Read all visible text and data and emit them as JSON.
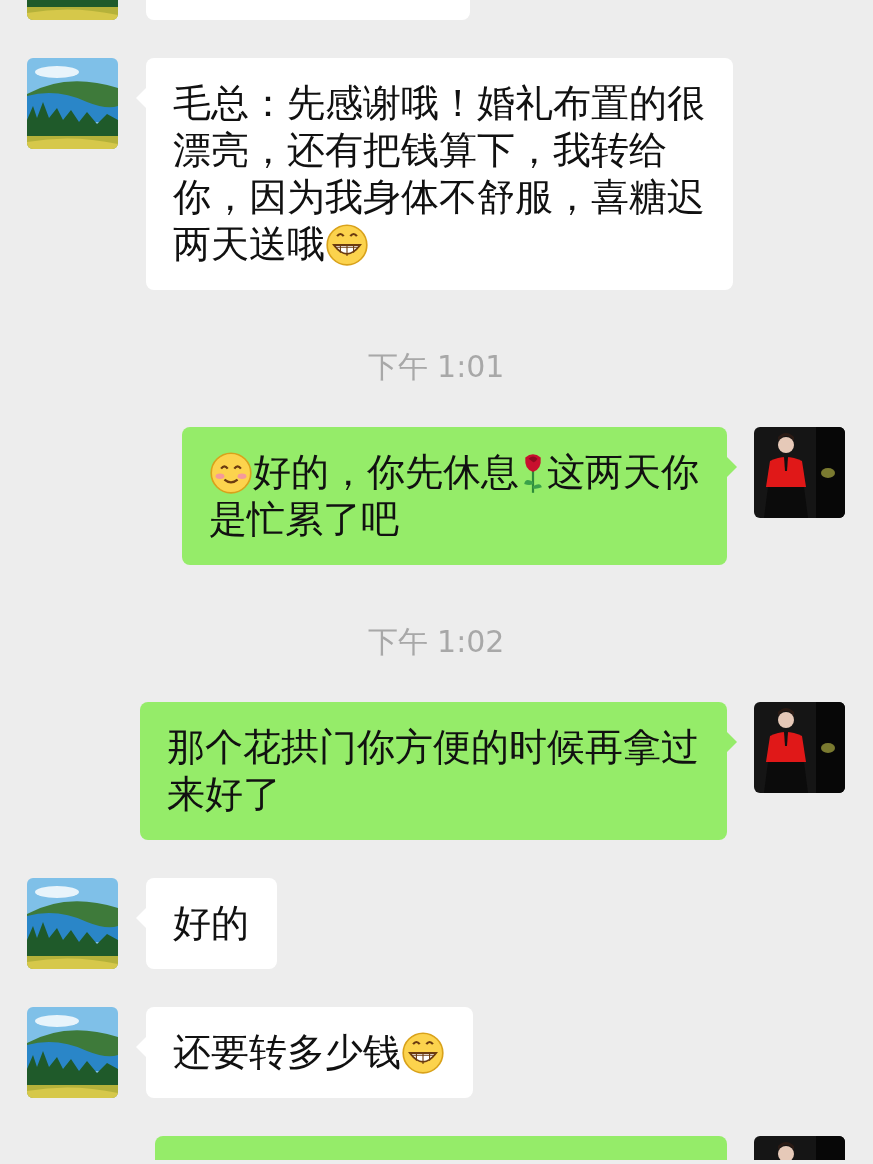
{
  "messages": [
    {
      "kind": "cut",
      "outgoing": false,
      "cut_top": true
    },
    {
      "kind": "message",
      "outgoing": false,
      "lines": [
        [
          {
            "kind": "text",
            "text": "毛总：先感谢哦！婚礼布置的很"
          }
        ],
        [
          {
            "kind": "text",
            "text": "漂亮，还有把钱算下，我转给"
          }
        ],
        [
          {
            "kind": "text",
            "text": "你，因为我身体不舒服，喜糖迟"
          }
        ],
        [
          {
            "kind": "text",
            "text": "两天送哦"
          },
          {
            "kind": "grin"
          }
        ]
      ]
    },
    {
      "kind": "time",
      "text": "下午 1:01"
    },
    {
      "kind": "message",
      "outgoing": true,
      "lines": [
        [
          {
            "kind": "smile"
          },
          {
            "kind": "text",
            "text": "好的，你先休息"
          },
          {
            "kind": "rose"
          },
          {
            "kind": "text",
            "text": "这两天你"
          }
        ],
        [
          {
            "kind": "text",
            "text": "是忙累了吧"
          }
        ]
      ]
    },
    {
      "kind": "time",
      "text": "下午 1:02"
    },
    {
      "kind": "message",
      "outgoing": true,
      "lines": [
        [
          {
            "kind": "text",
            "text": "那个花拱门你方便的时候再拿过"
          }
        ],
        [
          {
            "kind": "text",
            "text": "来好了"
          }
        ]
      ]
    },
    {
      "kind": "message",
      "outgoing": false,
      "lines": [
        [
          {
            "kind": "text",
            "text": "好的"
          }
        ]
      ]
    },
    {
      "kind": "message",
      "outgoing": false,
      "lines": [
        [
          {
            "kind": "text",
            "text": "还要转多少钱"
          },
          {
            "kind": "grin"
          }
        ]
      ]
    },
    {
      "kind": "cut",
      "outgoing": true,
      "cut_top": false
    }
  ]
}
